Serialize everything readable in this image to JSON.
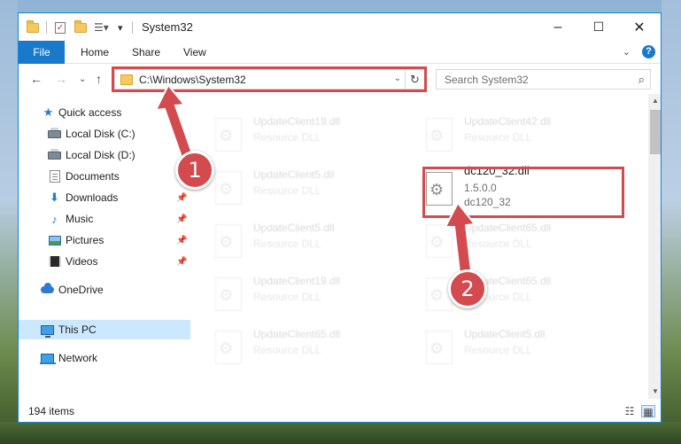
{
  "window": {
    "title": "System32",
    "controls": {
      "minimize": "–",
      "maximize": "☐",
      "close": "✕"
    }
  },
  "ribbon": {
    "file_tab": "File",
    "tabs": [
      "Home",
      "Share",
      "View"
    ],
    "collapse_glyph": "⌄",
    "help_glyph": "?"
  },
  "navigation": {
    "back": "←",
    "forward": "→",
    "recent": "⌄",
    "up": "↑",
    "address": "C:\\Windows\\System32",
    "address_dropdown": "⌄",
    "refresh": "↻",
    "search_placeholder": "Search System32",
    "search_glyph": "⌕"
  },
  "sidebar": {
    "items": [
      {
        "label": "Quick access",
        "icon": "star-icon",
        "pinned": false
      },
      {
        "label": "Local Disk (C:)",
        "icon": "disk-icon",
        "pinned": false
      },
      {
        "label": "Local Disk (D:)",
        "icon": "disk-icon",
        "pinned": false
      },
      {
        "label": "Documents",
        "icon": "documents-icon",
        "pinned": true
      },
      {
        "label": "Downloads",
        "icon": "downloads-icon",
        "pinned": true
      },
      {
        "label": "Music",
        "icon": "music-icon",
        "pinned": true
      },
      {
        "label": "Pictures",
        "icon": "pictures-icon",
        "pinned": true
      },
      {
        "label": "Videos",
        "icon": "videos-icon",
        "pinned": true
      },
      {
        "label": "OneDrive",
        "icon": "onedrive-icon",
        "pinned": false
      },
      {
        "label": "This PC",
        "icon": "this-pc-icon",
        "pinned": false,
        "selected": true
      },
      {
        "label": "Network",
        "icon": "network-icon",
        "pinned": false
      }
    ],
    "pin_glyph": "📌"
  },
  "files": [
    {
      "name": "UpdateClient19.dll",
      "desc": "Resource DLL"
    },
    {
      "name": "UpdateClient42.dll",
      "desc": "Resource DLL"
    },
    {
      "name": "UpdateClient5.dll",
      "desc": "Resource DLL"
    },
    {
      "name": "dc120_32.dll",
      "version": "1.5.0.0",
      "desc": "dc120_32",
      "highlighted": true
    },
    {
      "name": "UpdateClient5.dll",
      "desc": "Resource DLL"
    },
    {
      "name": "UpdateClient65.dll",
      "desc": "Resource DLL"
    },
    {
      "name": "UpdateClient19.dll",
      "desc": "Resource DLL"
    },
    {
      "name": "UpdateClient65.dll",
      "desc": "Resource DLL"
    },
    {
      "name": "UpdateClient65.dll",
      "desc": "Resource DLL"
    },
    {
      "name": "UpdateClient5.dll",
      "desc": "Resource DLL"
    }
  ],
  "scrollbar": {
    "up": "▲",
    "down": "▼"
  },
  "status": {
    "item_count": "194 items",
    "details_view_glyph": "☷",
    "tiles_view_glyph": "▦"
  },
  "annotations": {
    "step1": "1",
    "step2": "2",
    "highlight_color": "#d34a4f"
  }
}
